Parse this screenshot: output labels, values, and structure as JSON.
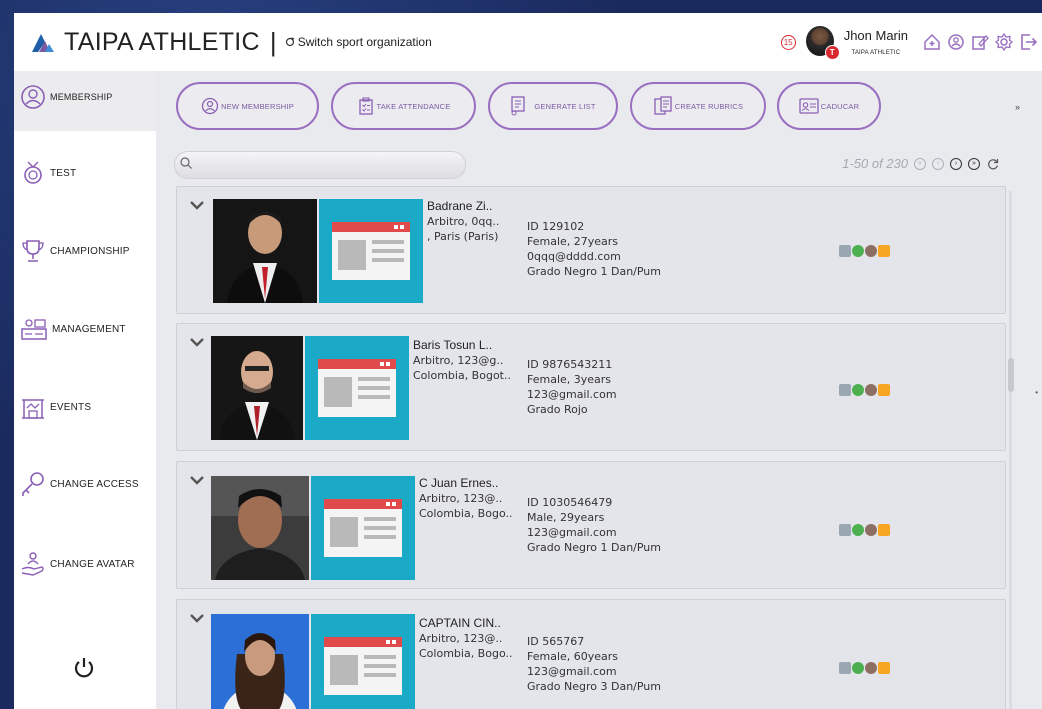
{
  "header": {
    "brand": "TAIPA ATHLETIC",
    "separator": "|",
    "switch_org": "Switch sport organization",
    "notification_count": "15",
    "user_name": "Jhon Marin",
    "user_org": "TAIPA ATHLETIC",
    "accent": "#9a6fc0"
  },
  "sidebar": {
    "items": [
      {
        "label": "MEMBERSHIP",
        "icon": "user-circle-icon"
      },
      {
        "label": "TEST",
        "icon": "medal-icon"
      },
      {
        "label": "CHAMPIONSHIP",
        "icon": "trophy-icon"
      },
      {
        "label": "MANAGEMENT",
        "icon": "management-icon"
      },
      {
        "label": "EVENTS",
        "icon": "events-icon"
      },
      {
        "label": "CHANGE ACCESS",
        "icon": "key-icon"
      },
      {
        "label": "CHANGE AVATAR",
        "icon": "avatar-hand-icon"
      }
    ],
    "power_icon": "power-icon"
  },
  "actions": {
    "new_membership": "NEW MEMBERSHIP",
    "take_attendance": "TAKE ATTENDANCE",
    "generate_list": "GENERATE LIST",
    "create_rubrics": "CREATE RUBRICS",
    "caducar": "CADUCAR",
    "more": "»"
  },
  "search": {
    "placeholder": ""
  },
  "pager": {
    "text": "1-50 of 230"
  },
  "members": [
    {
      "name": "Badrane Zi..",
      "role": "Arbitro, 0qq..",
      "location": ", Paris (Paris)",
      "id": "ID 129102",
      "gender_age": "Female, 27years",
      "email": "0qqq@dddd.com",
      "grade": "Grado Negro 1 Dan/Pum"
    },
    {
      "name": "Baris Tosun L..",
      "role": "Arbitro, 123@g..",
      "location": "Colombia, Bogot..",
      "id": "ID 9876543211",
      "gender_age": "Female, 3years",
      "email": "123@gmail.com",
      "grade": "Grado Rojo"
    },
    {
      "name": "C Juan Ernes..",
      "role": "Arbitro, 123@..",
      "location": "Colombia, Bogo..",
      "id": "ID 1030546479",
      "gender_age": "Male, 29years",
      "email": "123@gmail.com",
      "grade": "Grado Negro 1 Dan/Pum"
    },
    {
      "name": "CAPTAIN CIN..",
      "role": "Arbitro, 123@..",
      "location": "Colombia, Bogo..",
      "id": "ID 565767",
      "gender_age": "Female, 60years",
      "email": "123@gmail.com",
      "grade": "Grado Negro 3 Dan/Pum"
    }
  ]
}
